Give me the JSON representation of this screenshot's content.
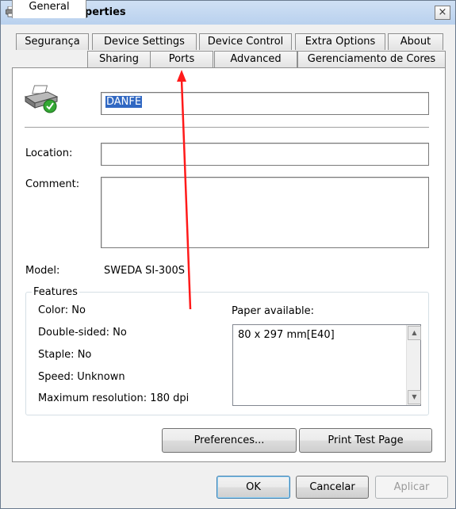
{
  "window": {
    "title": "DANFE Properties",
    "close_glyph": "×"
  },
  "tabs_row1": [
    "Segurança",
    "Device Settings",
    "Device Control",
    "Extra Options",
    "About"
  ],
  "tabs_row2": [
    "General",
    "Sharing",
    "Ports",
    "Advanced",
    "Gerenciamento de Cores"
  ],
  "general": {
    "printer_name": "DANFE",
    "location_label": "Location:",
    "location_value": "",
    "comment_label": "Comment:",
    "comment_value": "",
    "model_label": "Model:",
    "model_value": "SWEDA SI-300S"
  },
  "features": {
    "title": "Features",
    "color": "Color: No",
    "double_sided": "Double-sided: No",
    "staple": "Staple: No",
    "speed": "Speed: Unknown",
    "max_resolution": "Maximum resolution: 180 dpi",
    "paper_label": "Paper available:",
    "paper_items": [
      "80 x 297 mm[E40]"
    ]
  },
  "buttons": {
    "preferences": "Preferences...",
    "print_test_page": "Print Test Page",
    "ok": "OK",
    "cancel": "Cancelar",
    "apply": "Aplicar"
  },
  "icons": {
    "printer": "printer-check-icon",
    "title": "printer-icon"
  },
  "colors": {
    "annotation_arrow": "#ff1a1a",
    "selection": "#3168c2"
  }
}
